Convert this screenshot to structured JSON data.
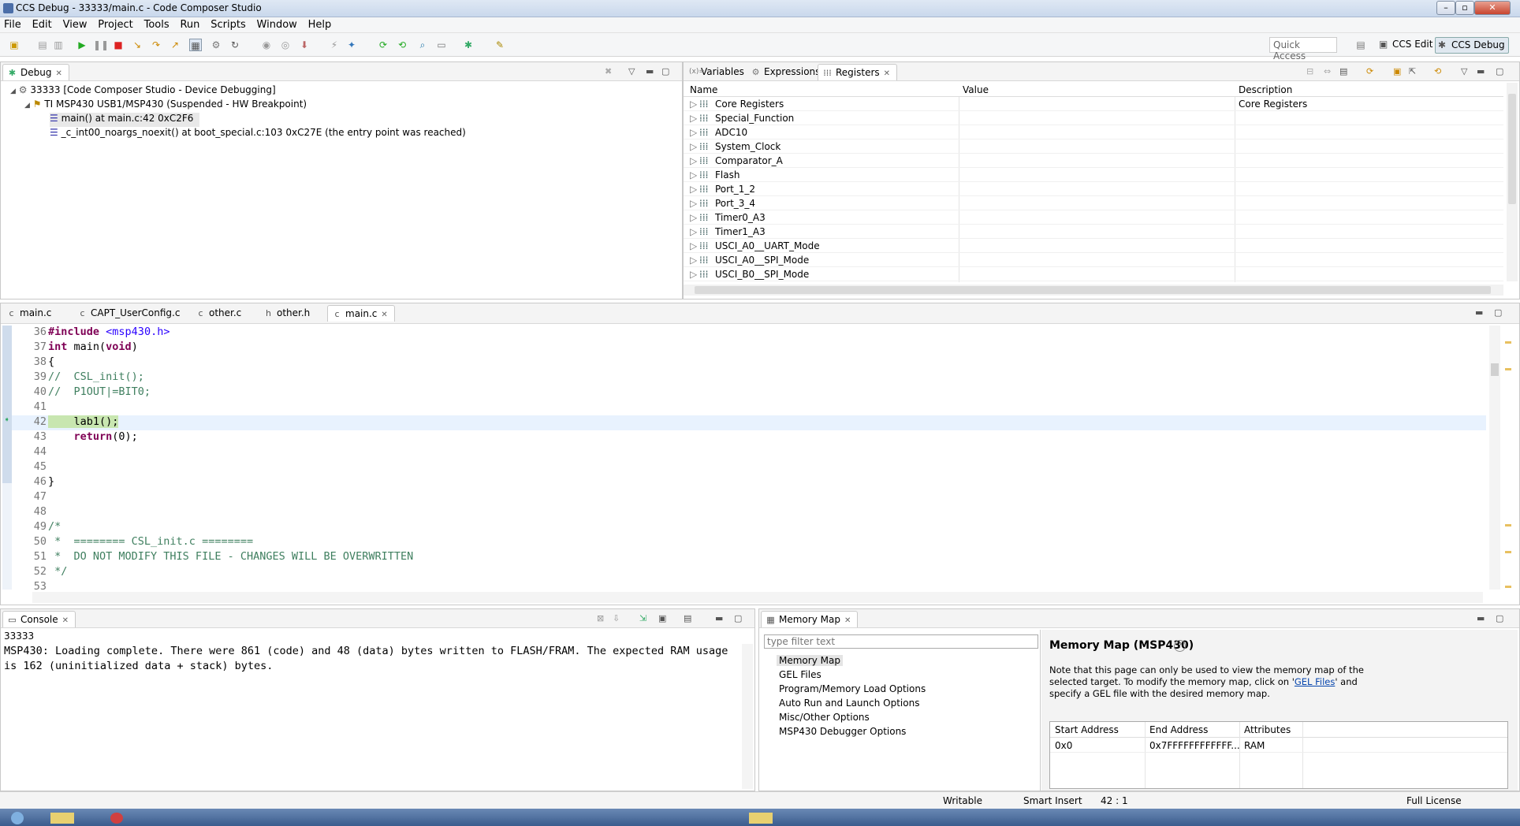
{
  "window": {
    "title": "CCS Debug - 33333/main.c - Code Composer Studio"
  },
  "menu": [
    "File",
    "Edit",
    "View",
    "Project",
    "Tools",
    "Run",
    "Scripts",
    "Window",
    "Help"
  ],
  "toolbar": {
    "quick_access": "Quick Access",
    "perspective_edit": "CCS Edit",
    "perspective_debug": "CCS Debug"
  },
  "debug_view": {
    "tab": "Debug",
    "items": [
      "33333 [Code Composer Studio - Device Debugging]",
      "TI MSP430 USB1/MSP430 (Suspended - HW Breakpoint)",
      "main() at main.c:42 0xC2F6",
      "_c_int00_noargs_noexit() at boot_special.c:103 0xC27E  (the entry point was reached)"
    ]
  },
  "registers_view": {
    "tabs": [
      "Variables",
      "Expressions",
      "Registers"
    ],
    "columns": [
      "Name",
      "Value",
      "Description"
    ],
    "rows": [
      {
        "name": "Core Registers",
        "value": "",
        "description": "Core Registers"
      },
      {
        "name": "Special_Function",
        "value": "",
        "description": ""
      },
      {
        "name": "ADC10",
        "value": "",
        "description": ""
      },
      {
        "name": "System_Clock",
        "value": "",
        "description": ""
      },
      {
        "name": "Comparator_A",
        "value": "",
        "description": ""
      },
      {
        "name": "Flash",
        "value": "",
        "description": ""
      },
      {
        "name": "Port_1_2",
        "value": "",
        "description": ""
      },
      {
        "name": "Port_3_4",
        "value": "",
        "description": ""
      },
      {
        "name": "Timer0_A3",
        "value": "",
        "description": ""
      },
      {
        "name": "Timer1_A3",
        "value": "",
        "description": ""
      },
      {
        "name": "USCI_A0__UART_Mode",
        "value": "",
        "description": ""
      },
      {
        "name": "USCI_A0__SPI_Mode",
        "value": "",
        "description": ""
      },
      {
        "name": "USCI_B0__SPI_Mode",
        "value": "",
        "description": ""
      }
    ]
  },
  "editor": {
    "tabs": [
      "main.c",
      "CAPT_UserConfig.c",
      "other.c",
      "other.h",
      "main.c"
    ],
    "active_tab": 4,
    "lines": [
      {
        "n": "36",
        "text": "#include <msp430.h>"
      },
      {
        "n": "37",
        "text": "int main(void)"
      },
      {
        "n": "38",
        "text": "{"
      },
      {
        "n": "39",
        "text": "//  CSL_init();"
      },
      {
        "n": "40",
        "text": "//  P1OUT|=BIT0;"
      },
      {
        "n": "41",
        "text": ""
      },
      {
        "n": "42",
        "text": "    lab1();"
      },
      {
        "n": "43",
        "text": "    return(0);"
      },
      {
        "n": "44",
        "text": ""
      },
      {
        "n": "45",
        "text": ""
      },
      {
        "n": "46",
        "text": "}"
      },
      {
        "n": "47",
        "text": ""
      },
      {
        "n": "48",
        "text": ""
      },
      {
        "n": "49",
        "text": "/*"
      },
      {
        "n": "50",
        "text": " *  ======== CSL_init.c ========"
      },
      {
        "n": "51",
        "text": " *  DO NOT MODIFY THIS FILE - CHANGES WILL BE OVERWRITTEN"
      },
      {
        "n": "52",
        "text": " */"
      },
      {
        "n": "53",
        "text": ""
      }
    ]
  },
  "console": {
    "tab": "Console",
    "session": "33333",
    "output": "MSP430: Loading complete. There were 861 (code) and 48 (data) bytes written to FLASH/FRAM. The expected RAM usage is 162 (uninitialized data + stack) bytes."
  },
  "memory_map": {
    "tab": "Memory Map",
    "filter_placeholder": "type filter text",
    "nav_items": [
      "Memory Map",
      "GEL Files",
      "Program/Memory Load Options",
      "Auto Run and Launch Options",
      "Misc/Other Options",
      "MSP430 Debugger Options"
    ],
    "heading": "Memory Map (MSP430)",
    "note_pre": "Note that this page can only be used to view the memory map of the selected target.  To modify the memory map, click on '",
    "note_link": "GEL Files",
    "note_post": "' and specify a GEL file with the desired memory map.",
    "columns": [
      "Start Address",
      "End Address",
      "Attributes"
    ],
    "rows": [
      {
        "start": "0x0",
        "end": "0x7FFFFFFFFFFFF...",
        "attr": "RAM"
      }
    ]
  },
  "status": {
    "writable": "Writable",
    "insert": "Smart Insert",
    "position": "42 : 1",
    "license": "Full License"
  }
}
